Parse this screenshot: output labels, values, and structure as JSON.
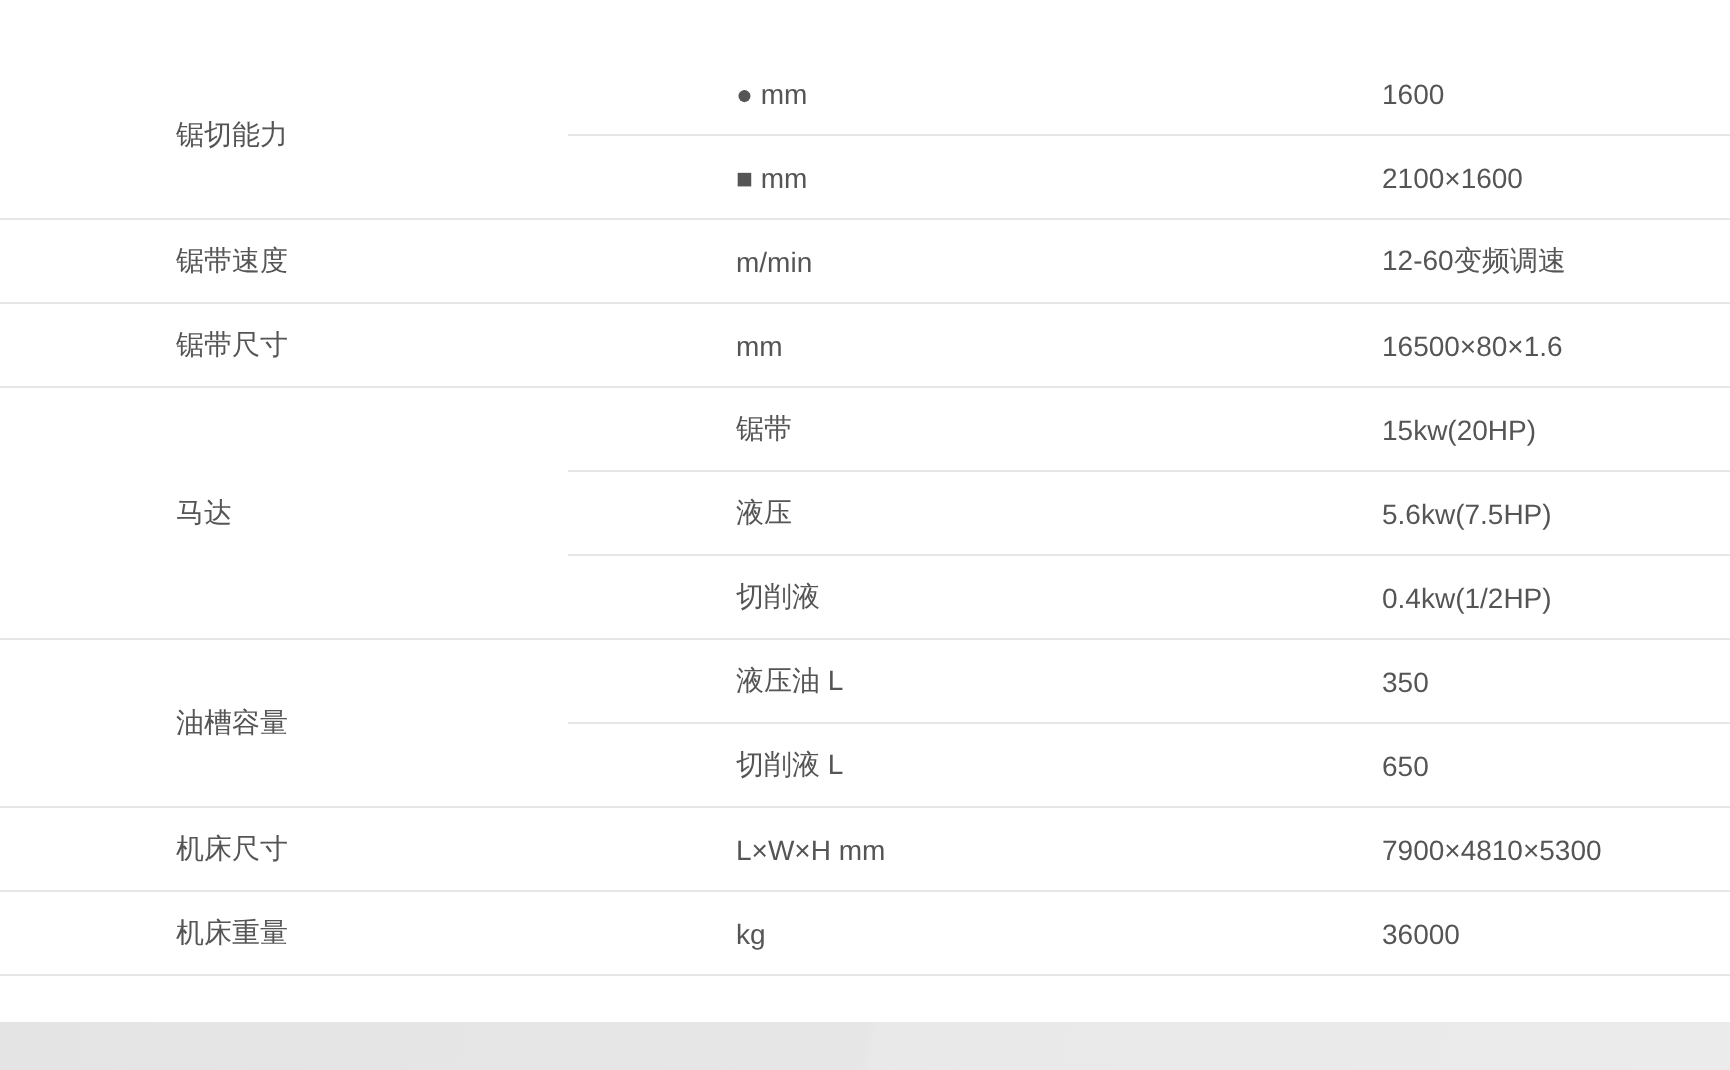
{
  "spec_table": [
    {
      "label": "锯切能力",
      "rows": [
        {
          "unit": "● mm",
          "value": "1600"
        },
        {
          "unit": "■ mm",
          "value": "2100×1600"
        }
      ]
    },
    {
      "label": "锯带速度",
      "rows": [
        {
          "unit": "m/min",
          "value": "12-60变频调速"
        }
      ]
    },
    {
      "label": "锯带尺寸",
      "rows": [
        {
          "unit": "mm",
          "value": "16500×80×1.6"
        }
      ]
    },
    {
      "label": "马达",
      "rows": [
        {
          "unit": "锯带",
          "value": "15kw(20HP)"
        },
        {
          "unit": "液压",
          "value": "5.6kw(7.5HP)"
        },
        {
          "unit": "切削液",
          "value": "0.4kw(1/2HP)"
        }
      ]
    },
    {
      "label": "油槽容量",
      "rows": [
        {
          "unit": "液压油 L",
          "value": "350"
        },
        {
          "unit": "切削液 L",
          "value": "650"
        }
      ]
    },
    {
      "label": "机床尺寸",
      "rows": [
        {
          "unit": "L×W×H mm",
          "value": "7900×4810×5300"
        }
      ]
    },
    {
      "label": "机床重量",
      "rows": [
        {
          "unit": "kg",
          "value": "36000"
        }
      ]
    }
  ]
}
